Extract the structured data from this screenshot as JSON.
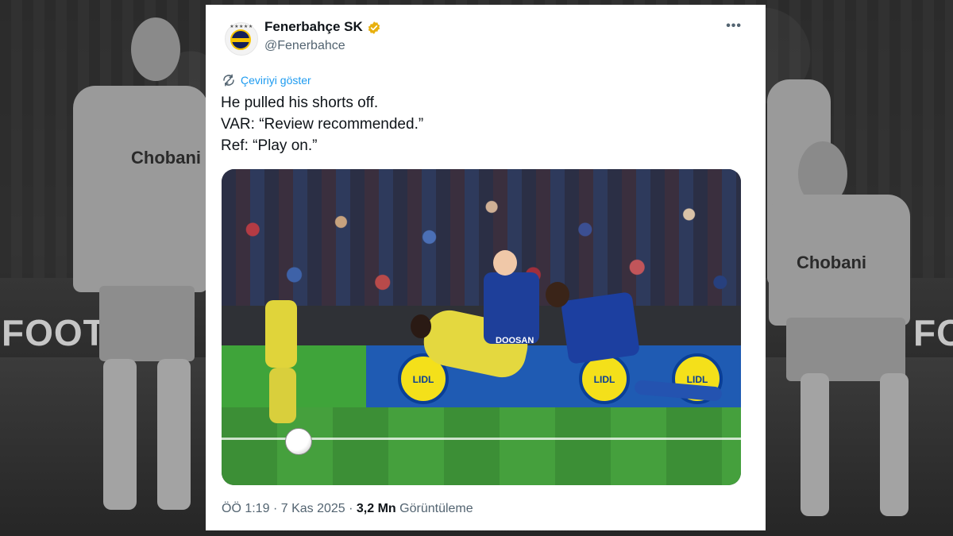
{
  "background": {
    "board_text_left": "FOOTBA",
    "board_text_right": "FOO",
    "sponsor_left": "Chobani",
    "sponsor_right": "Chobani"
  },
  "tweet": {
    "author_name": "Fenerbahçe SK",
    "handle": "@Fenerbahce",
    "verified": true,
    "translate_label": "Çeviriyi göster",
    "lines": [
      "He pulled his shorts off.",
      "VAR: “Review recommended.”",
      "Ref: “Play on.”"
    ],
    "photo": {
      "board_sponsor": "LIDL",
      "kit_sponsor": "DOOSAN"
    },
    "time": "ÖÖ 1:19",
    "date": "7 Kas 2025",
    "views_count": "3,2 Mn",
    "views_label": "Görüntüleme",
    "separator": "·"
  },
  "colors": {
    "link": "#1d9bf0",
    "text": "#0f1419",
    "muted": "#536471",
    "verified_badge": "#e8b00e"
  },
  "icons": [
    "verified-badge-icon",
    "more-icon",
    "translate-icon"
  ]
}
